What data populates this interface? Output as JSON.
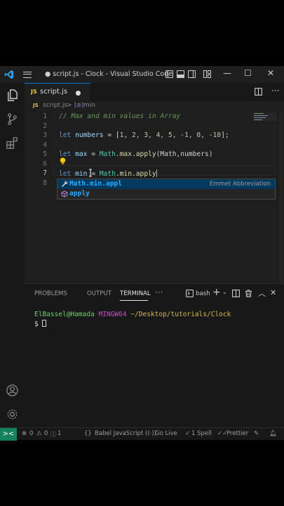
{
  "window": {
    "title": "● script.js - Clock - Visual Studio Code",
    "minimize": "—",
    "maximize": "☐",
    "close": "✕"
  },
  "tab": {
    "icon_text": "JS",
    "name": "script.js"
  },
  "breadcrumb": {
    "file": "script.js",
    "separator": ">",
    "symbol": "min"
  },
  "editor": {
    "line_numbers": [
      "1",
      "2",
      "3",
      "4",
      "5",
      "6",
      "7",
      "8"
    ],
    "comment": "// Max and min values in Array",
    "line3": {
      "kw": "let",
      "name": "numbers",
      "eq": " = [",
      "values": "1, 2, 3, 4, 5, -1, 0, -10",
      "end": "];"
    },
    "line5": {
      "kw": "let",
      "name": "max",
      "eq": " = ",
      "obj": "Math",
      "dot1": ".",
      "prop": "max",
      "dot2": ".",
      "fn": "apply",
      "args": "(Math,numbers)"
    },
    "line7": {
      "kw": "let",
      "name": "min",
      "eq": " = ",
      "obj": "Math",
      "dot1": ".",
      "prop": "min",
      "dot2": ".",
      "fn": "apply"
    }
  },
  "suggestions": [
    {
      "label_match": "Math.min.appl",
      "label_rest": "",
      "detail": "Emmet Abbreviation",
      "selected": true
    },
    {
      "label_match": "apply",
      "label_rest": "",
      "detail": "",
      "selected": false
    }
  ],
  "panel": {
    "tabs": [
      "PROBLEMS",
      "OUTPUT",
      "TERMINAL",
      "···"
    ],
    "active_tab": "TERMINAL",
    "shell": "bash",
    "terminal": {
      "user": "ElBassel@Hamada",
      "host": "MINGW64",
      "path": "~/Desktop/tutorials/Clock",
      "prompt": "$ "
    }
  },
  "statusbar": {
    "remote": "><",
    "errors": "0",
    "warnings": "0",
    "info": "1",
    "language": "Babel JavaScript",
    "golive": "Go Live",
    "spell": "1 Spell",
    "prettier": "Prettier"
  },
  "colors": {
    "accent": "#0078d4",
    "remote": "#16825d",
    "js_icon": "#e8c84a"
  }
}
